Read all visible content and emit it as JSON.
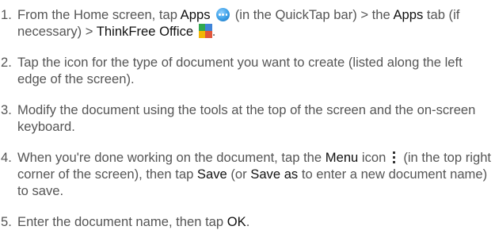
{
  "steps": [
    {
      "number": "1.",
      "text_a": "From the Home screen, tap ",
      "apps": "Apps",
      "text_b": " (in the QuickTap bar) > the ",
      "apps_tab": "Apps",
      "text_c": " tab (if necessary) > ",
      "thinkfree": "ThinkFree Office",
      "text_d": "."
    },
    {
      "number": "2.",
      "text": "Tap the icon for the type of document you want to create (listed along the left edge of the screen)."
    },
    {
      "number": "3.",
      "text": "Modify the document using the tools at the top of the screen and the on-screen keyboard."
    },
    {
      "number": "4.",
      "text_a": "When you're done working on the document, tap the ",
      "menu": "Menu",
      "text_b": " icon",
      "text_c": "(in the top right corner of the screen), then tap ",
      "save": "Save",
      "text_d": " (or ",
      "save_as": "Save as",
      "text_e": " to enter a new document name) to save."
    },
    {
      "number": "5.",
      "text_a": "Enter the document name, then tap ",
      "ok": "OK",
      "text_b": "."
    }
  ],
  "icons": {
    "apps_icon": "apps-icon",
    "thinkfree_icon": "thinkfree-office-icon",
    "menu_icon": "menu-icon"
  }
}
